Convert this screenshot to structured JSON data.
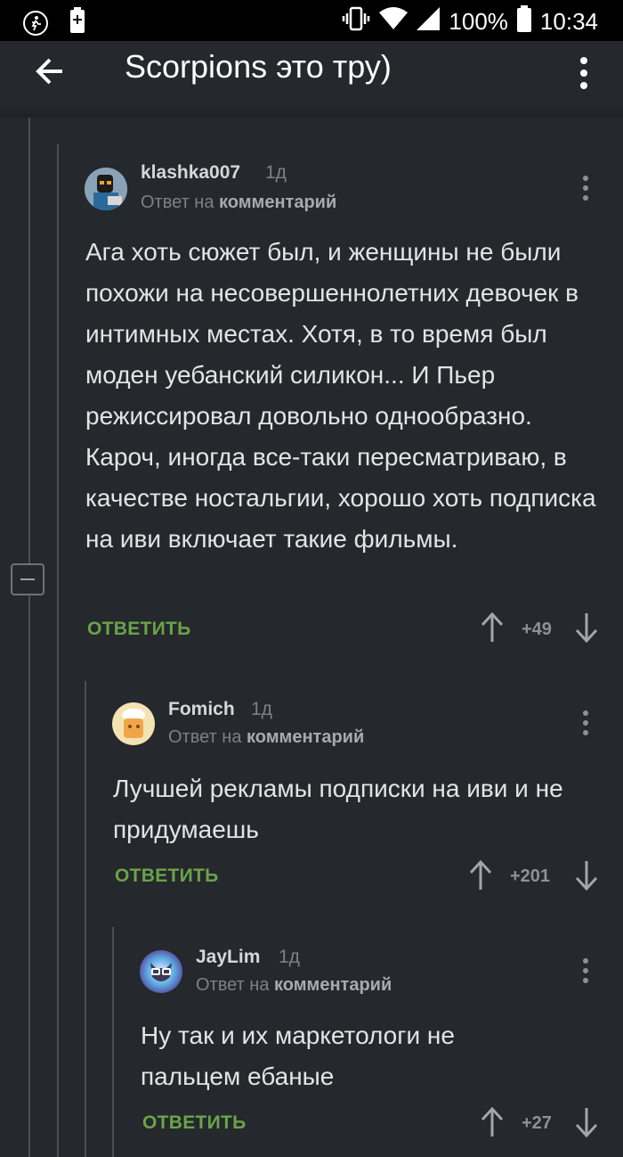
{
  "status": {
    "battery": "100%",
    "time": "10:34"
  },
  "appbar": {
    "title": "Scorpions это тру)"
  },
  "comments": [
    {
      "author": "klashka007",
      "time": "1д",
      "reply_prefix": "Ответ на",
      "reply_link": "комментарий",
      "text": "Ага хоть сюжет был, и женщины не были похожи на несовершеннолетних девочек в интимных местах. Хотя, в то время был моден уебанский силикон... И Пьер режиссировал довольно однообразно. Кароч, иногда все-таки пересматриваю, в качестве ностальгии, хорошо хоть подписка на иви включает такие фильмы.",
      "reply_label": "ОТВЕТИТЬ",
      "score": "+49"
    },
    {
      "author": "Fomich",
      "time": "1д",
      "reply_prefix": "Ответ на",
      "reply_link": "комментарий",
      "text": "Лучшей рекламы подписки на иви и не придумаешь",
      "reply_label": "ОТВЕТИТЬ",
      "score": "+201"
    },
    {
      "author": "JayLim",
      "time": "1д",
      "reply_prefix": "Ответ на",
      "reply_link": "комментарий",
      "text": "Ну так и их маркетологи не пальцем ебаные",
      "reply_label": "ОТВЕТИТЬ",
      "score": "+27"
    }
  ],
  "colors": {
    "background": "#25282c",
    "accent": "#6aa34a",
    "muted": "#7d8187"
  }
}
